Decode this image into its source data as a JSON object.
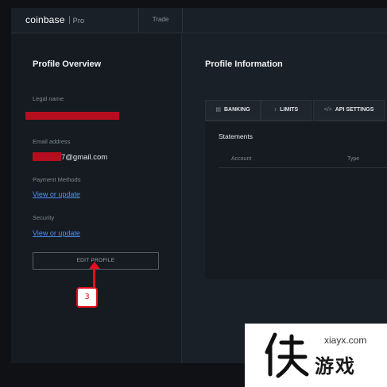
{
  "header": {
    "logo": "coinbase",
    "logo_suffix": "Pro",
    "trade_tab": "Trade"
  },
  "sidebar": {
    "title": "Profile Overview",
    "legal_name_label": "Legal name",
    "email_label": "Email address",
    "email_value": "7@gmail.com",
    "payment_label": "Payment Methods",
    "payment_link": "View or update",
    "security_label": "Security",
    "security_link": "View or update",
    "edit_button": "EDIT PROFILE"
  },
  "annotation": {
    "step": "3",
    "color": "#e0101f"
  },
  "main": {
    "title": "Profile Information",
    "tabs": [
      {
        "icon": "bank-icon",
        "label": "BANKING"
      },
      {
        "icon": "limits-icon",
        "label": "LIMITS"
      },
      {
        "icon": "code-icon",
        "label": "API SETTINGS"
      }
    ],
    "statements_title": "Statements",
    "columns": [
      "Account",
      "Type"
    ]
  },
  "watermark": {
    "url": "xiayx.com",
    "text": "游戏"
  },
  "colors": {
    "link": "#4f8df5",
    "redaction": "#b50f1f",
    "background": "#1a2027"
  }
}
